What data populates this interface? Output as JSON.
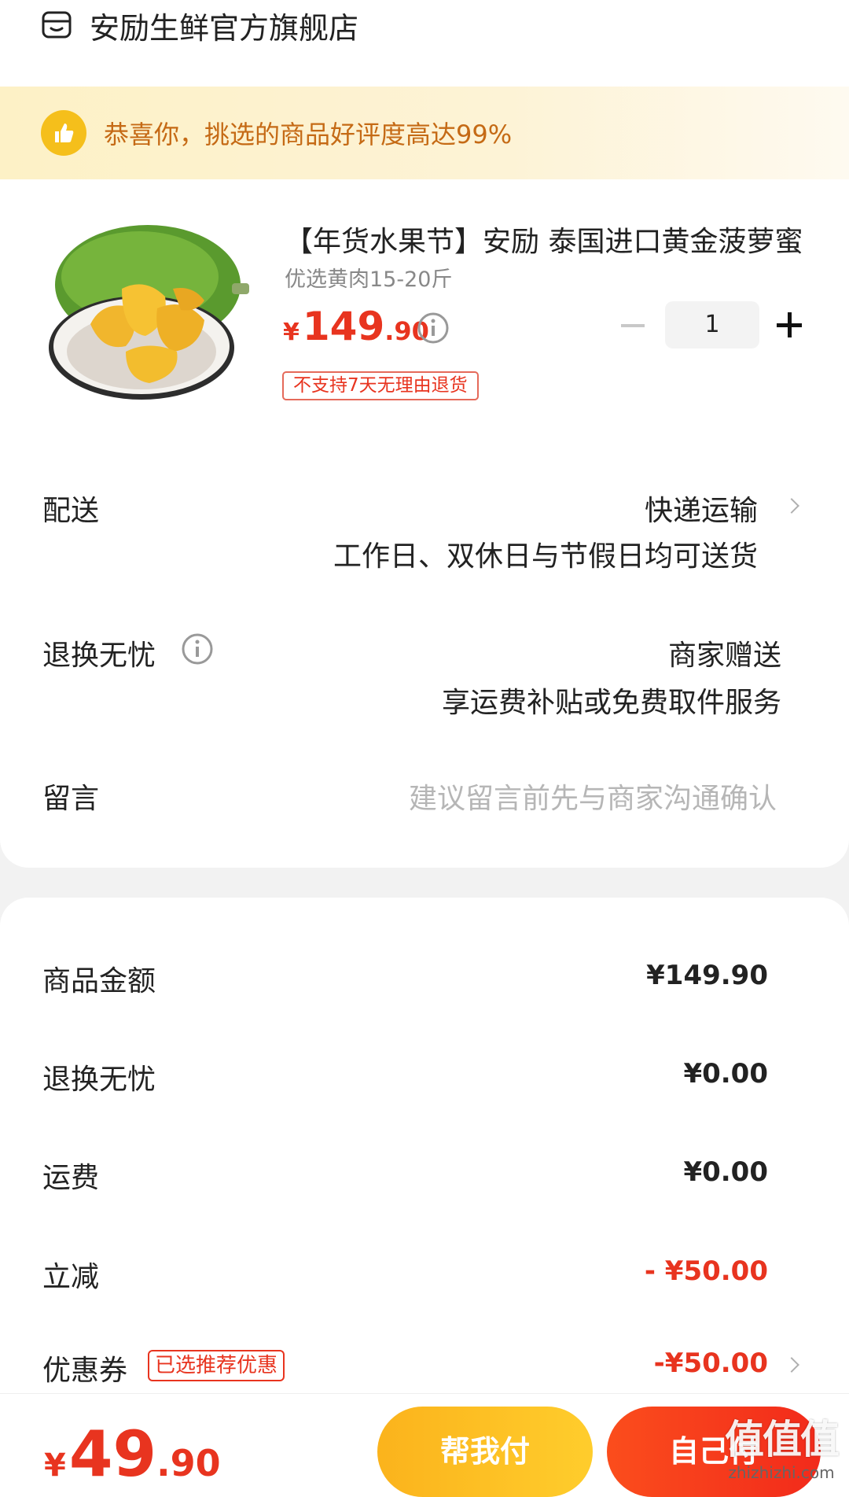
{
  "store": {
    "name": "安励生鲜官方旗舰店",
    "icon": "store-icon"
  },
  "banner": {
    "text": "恭喜你，挑选的商品好评度高达99%",
    "icon": "thumbs-up-icon",
    "accent": "#f5bf1b"
  },
  "product": {
    "title": "【年货水果节】安励 泰国进口黄金菠萝蜜",
    "spec": "优选黄肉15-20斤",
    "price_currency": "¥",
    "price_int": "149",
    "price_dec": ".90",
    "tag": "不支持7天无理由退货",
    "quantity": "1"
  },
  "delivery": {
    "label": "配送",
    "method": "快递运输",
    "note": "工作日、双休日与节假日均可送货"
  },
  "return_service": {
    "label": "退换无忧",
    "value": "商家赠送",
    "desc": "享运费补贴或免费取件服务"
  },
  "remark": {
    "label": "留言",
    "placeholder": "建议留言前先与商家沟通确认"
  },
  "summary": {
    "goods_label": "商品金额",
    "goods_value": "¥149.90",
    "return_label": "退换无忧",
    "return_value": "¥0.00",
    "shipping_label": "运费",
    "shipping_value": "¥0.00",
    "discount_label": "立减",
    "discount_value": "- ¥50.00",
    "coupon_label": "优惠券",
    "coupon_tag": "已选推荐优惠",
    "coupon_value": "-¥50.00"
  },
  "footer": {
    "total_currency": "¥",
    "total_int": "49",
    "total_dec": ".90",
    "help_pay": "帮我付",
    "self_pay": "自己付",
    "watermark": "值值值",
    "watermark_url": "zhizhizhi.com"
  },
  "colors": {
    "price_red": "#e8341f",
    "banner_text": "#c56a15",
    "help_button": "#fbb31c",
    "self_button": "#f22a1b"
  }
}
